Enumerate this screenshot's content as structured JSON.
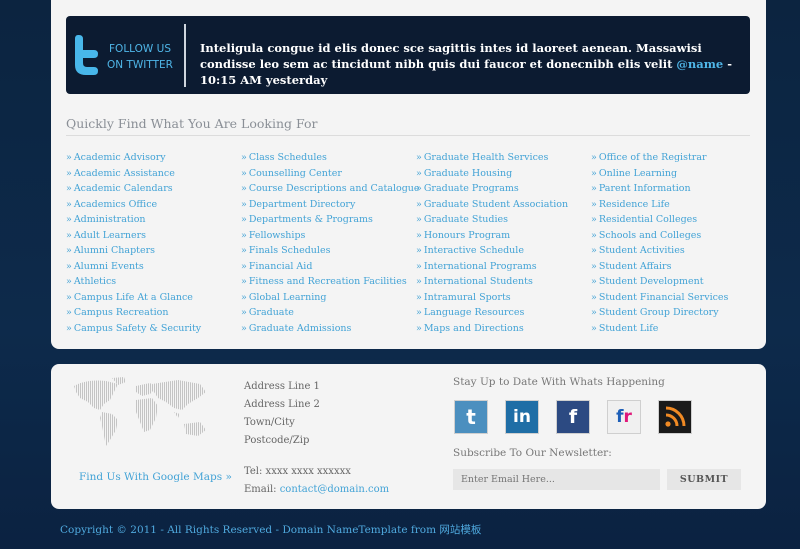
{
  "twitter": {
    "follow_line1": "FOLLOW US",
    "follow_line2": "ON TWITTER",
    "tweet_text": "Inteligula congue id elis donec sce sagittis intes id laoreet aenean. Massawisi condisse leo sem ac tincidunt nibh quis dui faucor et donecnibh elis velit",
    "handle": "@name",
    "time": " - 10:15 AM yesterday"
  },
  "quick_find": {
    "title": "Quickly Find What You Are Looking For",
    "bullet": "»",
    "columns": [
      [
        "Academic Advisory",
        "Academic Assistance",
        "Academic Calendars",
        "Academics Office",
        "Administration",
        "Adult Learners",
        "Alumni Chapters",
        "Alumni Events",
        "Athletics",
        "Campus Life At a Glance",
        "Campus Recreation",
        "Campus Safety & Security"
      ],
      [
        "Class Schedules",
        "Counselling Center",
        "Course Descriptions and Catalogue",
        "Department Directory",
        "Departments & Programs",
        "Fellowships",
        "Finals Schedules",
        "Financial Aid",
        "Fitness and Recreation Facilities",
        "Global Learning",
        "Graduate",
        "Graduate Admissions"
      ],
      [
        "Graduate Health Services",
        "Graduate Housing",
        "Graduate Programs",
        "Graduate Student Association",
        "Graduate Studies",
        "Honours Program",
        "Interactive Schedule",
        "International Programs",
        "International Students",
        "Intramural Sports",
        "Language Resources",
        "Maps and Directions"
      ],
      [
        "Office of the Registrar",
        "Online Learning",
        "Parent Information",
        "Residence Life",
        "Residential Colleges",
        "Schools and Colleges",
        "Student Activities",
        "Student Affairs",
        "Student Development",
        "Student Financial Services",
        "Student Group Directory",
        "Student Life"
      ]
    ]
  },
  "footer": {
    "maps_link": "Find Us With Google Maps »",
    "address": [
      "Address Line 1",
      "Address Line 2",
      "Town/City",
      "Postcode/Zip"
    ],
    "tel": "Tel: xxxx xxxx xxxxxx",
    "email_label": "Email: ",
    "email": "contact@domain.com",
    "stay_title": "Stay Up to Date With Whats Happening",
    "subscribe_title": "Subscribe To Our Newsletter:",
    "email_placeholder": "Enter Email Here...",
    "submit_label": "SUBMIT",
    "social_icons": [
      "twitter-icon",
      "linkedin-icon",
      "facebook-icon",
      "flickr-icon",
      "rss-icon"
    ]
  },
  "copyright": "Copyright © 2011 - All Rights Reserved - Domain NameTemplate from 网站模板",
  "colors": {
    "link": "#43a3d6",
    "background": "#0d2a4b",
    "panel": "#f4f4f4",
    "twitter_bar": "#0c1b31"
  }
}
